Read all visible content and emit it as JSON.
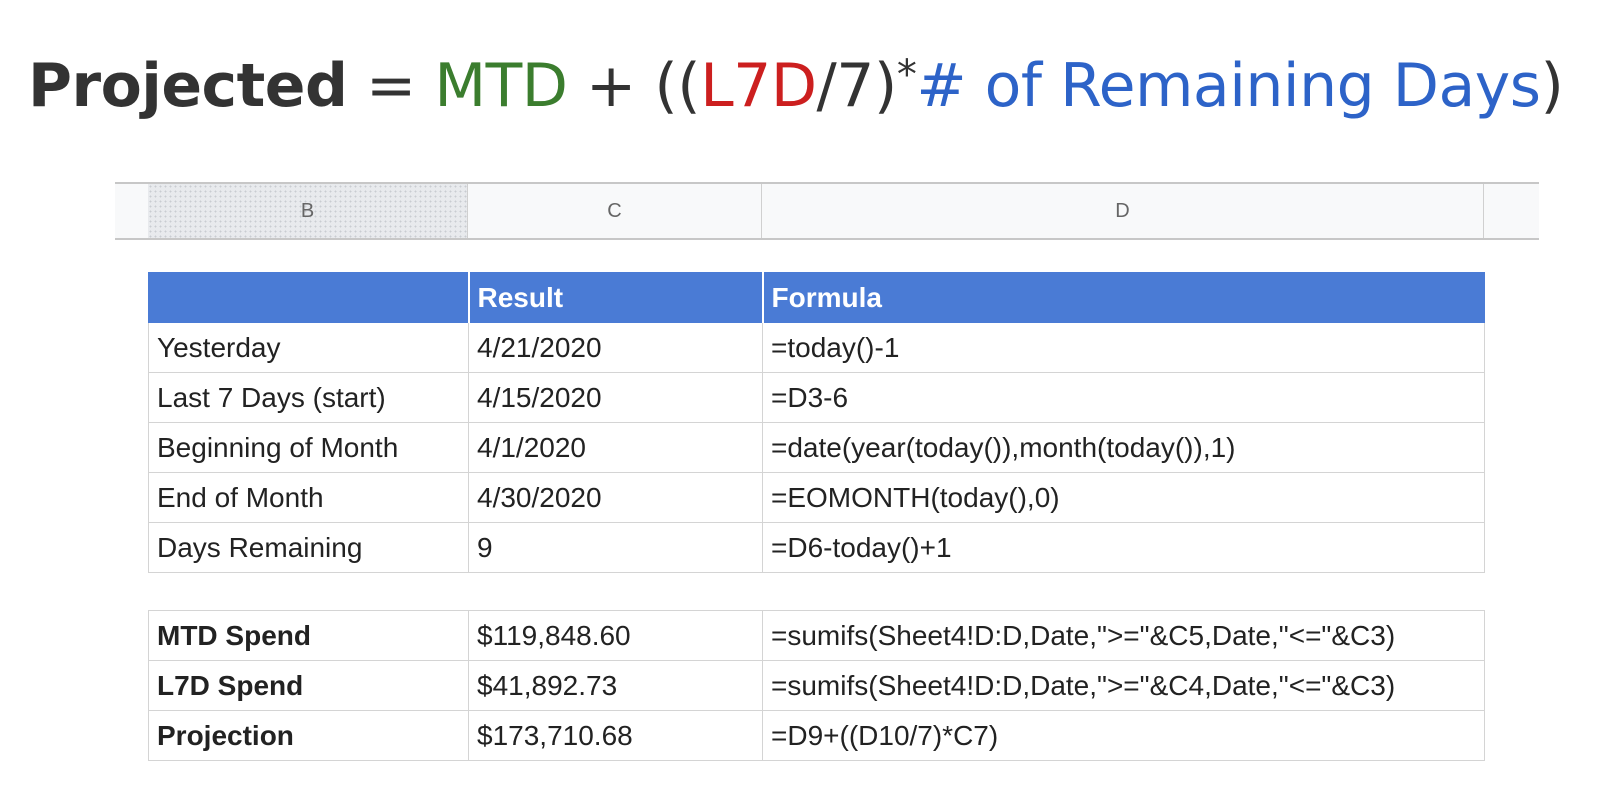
{
  "headline": {
    "projected": "Projected",
    "equals": " = ",
    "mtd": "MTD",
    "plus": " + ((",
    "l7d": "L7D",
    "div7": "/7)",
    "star": "*",
    "remaining": "# of Remaining Days",
    "close": ")",
    "colors": {
      "projected": "#333333",
      "mtd": "#3b7d2e",
      "l7d": "#cc1f1f",
      "remaining": "#2d63c8"
    }
  },
  "sheet": {
    "columns": [
      "B",
      "C",
      "D"
    ],
    "selected_column": "B",
    "header_color": "#4a7bd5",
    "header": {
      "label": "",
      "result": "Result",
      "formula": "Formula"
    },
    "rows": [
      {
        "label": "Yesterday",
        "result": "4/21/2020",
        "formula": "=today()-1"
      },
      {
        "label": "Last 7 Days (start)",
        "result": "4/15/2020",
        "formula": "=D3-6"
      },
      {
        "label": "Beginning of Month",
        "result": "4/1/2020",
        "formula": "=date(year(today()),month(today()),1)"
      },
      {
        "label": "End of Month",
        "result": "4/30/2020",
        "formula": "=EOMONTH(today(),0)"
      },
      {
        "label": "Days Remaining",
        "result": "9",
        "formula": "=D6-today()+1"
      }
    ],
    "spend_rows": [
      {
        "label": "MTD Spend",
        "result": "$119,848.60",
        "formula": "=sumifs(Sheet4!D:D,Date,\">=\"&C5,Date,\"<=\"&C3)"
      },
      {
        "label": "L7D Spend",
        "result": "$41,892.73",
        "formula": "=sumifs(Sheet4!D:D,Date,\">=\"&C4,Date,\"<=\"&C3)"
      },
      {
        "label": "Projection",
        "result": "$173,710.68",
        "formula": "=D9+((D10/7)*C7)"
      }
    ]
  }
}
